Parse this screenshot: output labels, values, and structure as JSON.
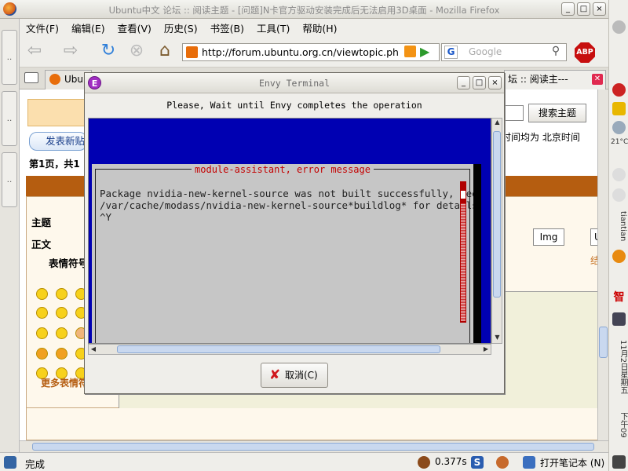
{
  "window": {
    "title": "Ubuntu中文 论坛 :: 阅读主题 - [问题]N卡官方驱动安装完成后无法启用3D桌面 - Mozilla Firefox",
    "controls": [
      "_",
      "□",
      "×"
    ]
  },
  "menubar": {
    "items": [
      "文件(F)",
      "编辑(E)",
      "查看(V)",
      "历史(S)",
      "书签(B)",
      "工具(T)",
      "帮助(H)"
    ]
  },
  "navbar": {
    "url": "http://forum.ubuntu.org.cn/viewtopic.ph",
    "search_placeholder": "Google",
    "abp_label": "ABP"
  },
  "tabs": [
    {
      "label": "Ubun"
    },
    {
      "label": "坛 :: 阅读主---"
    }
  ],
  "page": {
    "search_button": "搜索主题",
    "post_button": "发表新贴",
    "timezone_text": "时间均为 北京时间",
    "page_info": "第1页，共1",
    "subject_label": "主题",
    "body_label": "正文",
    "img_button": "Img",
    "u_button": "U",
    "orange_char": "结",
    "emote_title": "表情符号",
    "more_emotes": "更多表情符号"
  },
  "dialog": {
    "title": "Envy Terminal",
    "message": "Please, Wait until Envy completes the operation",
    "terminal_header": "module-assistant, error message",
    "terminal_lines": [
      "Package nvidia-new-kernel-source was not built successfully, see",
      "/var/cache/modass/nvidia-new-kernel-source*buildlog* for details!",
      "^Y"
    ],
    "cancel_label": "取消(C)"
  },
  "statusbar": {
    "status": "完成",
    "time": "0.377s",
    "note_label": "打开笔记本 (N)"
  },
  "tray": {
    "temp": "21°C",
    "user": "tiantian",
    "char": "智",
    "date": "11月2日星期五",
    "clock": "下午09"
  },
  "colors": {
    "terminal_bg": "#0000b2",
    "terminal_box": "#c6c6c6",
    "error_title": "#c40000",
    "forum_brown": "#b55d10"
  }
}
